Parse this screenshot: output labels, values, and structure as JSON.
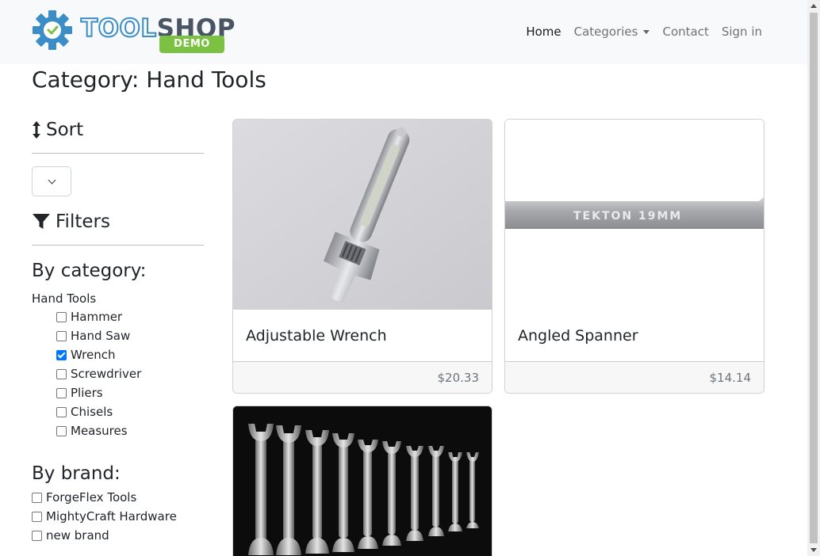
{
  "brand": {
    "logo_part1": "TOOL",
    "logo_part2": "SHOP",
    "logo_badge": "DEMO"
  },
  "nav": {
    "home": "Home",
    "categories": "Categories",
    "contact": "Contact",
    "signin": "Sign in"
  },
  "page": {
    "title": "Category: Hand Tools"
  },
  "sidebar": {
    "sort_heading": "Sort",
    "filters_heading": "Filters",
    "by_category_heading": "By category:",
    "parent_category": "Hand Tools",
    "categories": [
      {
        "label": "Hammer",
        "checked": false
      },
      {
        "label": "Hand Saw",
        "checked": false
      },
      {
        "label": "Wrench",
        "checked": true
      },
      {
        "label": "Screwdriver",
        "checked": false
      },
      {
        "label": "Pliers",
        "checked": false
      },
      {
        "label": "Chisels",
        "checked": false
      },
      {
        "label": "Measures",
        "checked": false
      }
    ],
    "by_brand_heading": "By brand:",
    "brands": [
      {
        "label": "ForgeFlex Tools",
        "checked": false
      },
      {
        "label": "MightyCraft Hardware",
        "checked": false
      },
      {
        "label": "new brand",
        "checked": false
      }
    ]
  },
  "products": [
    {
      "name": "Adjustable Wrench",
      "price": "$20.33",
      "image": "adjustable-wrench-photo"
    },
    {
      "name": "Angled Spanner",
      "price": "$14.14",
      "image": "angled-spanner-photo",
      "image_text": "TEKTON 19MM"
    },
    {
      "name": "",
      "price": "",
      "image": "open-end-spanners-photo"
    }
  ],
  "colors": {
    "accent": "#7cc242",
    "logo_blue": "#3a8dc6",
    "checkbox": "#0075ff"
  }
}
